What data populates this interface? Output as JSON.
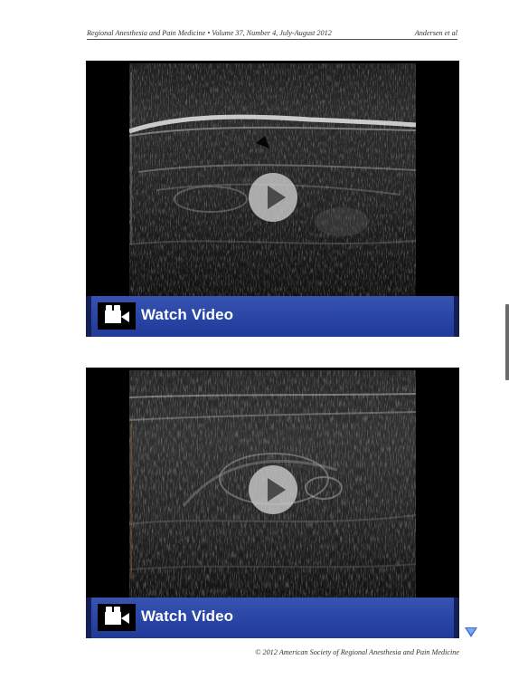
{
  "header": {
    "journal": "Regional Anesthesia and Pain Medicine  •  Volume 37, Number 4, July-August 2012",
    "authors": "Andersen et al"
  },
  "videos": [
    {
      "watch_label": "Watch Video"
    },
    {
      "watch_label": "Watch Video"
    }
  ],
  "footer": {
    "copyright": "© 2012 American Society of Regional Anesthesia and Pain Medicine"
  },
  "icons": {
    "play": "play-icon",
    "camera": "video-camera-icon",
    "next": "down-arrow-icon"
  },
  "colors": {
    "watch_bar": "#2a46a6",
    "watch_bar_edge": "#141f55",
    "next_arrow": "#3b6fd8"
  }
}
